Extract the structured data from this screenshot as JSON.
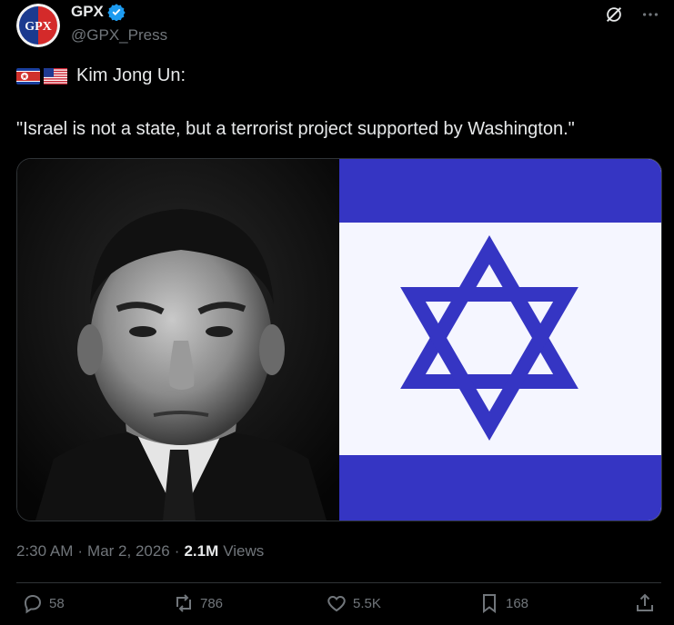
{
  "author": {
    "avatar_text": "GPX",
    "display_name": "GPX",
    "handle": "@GPX_Press",
    "verified_badge_icon": "verified-badge-icon"
  },
  "top_actions": {
    "grok_icon": "grok-icon",
    "more_icon": "more-icon"
  },
  "post": {
    "flags": [
      "north-korea-flag",
      "usa-flag"
    ],
    "speaker": "Kim Jong Un:",
    "quote": "\"Israel is not a state, but a terrorist project supported by Washington.\""
  },
  "media": {
    "left_image": "portrait-photo",
    "right_image": "israel-flag",
    "flag_colors": {
      "blue": "#3535c3",
      "white": "#f5f6ff"
    }
  },
  "meta": {
    "time": "2:30 AM",
    "separator": "·",
    "date": "Mar 2, 2026",
    "views_count": "2.1M",
    "views_label": "Views"
  },
  "actions": {
    "replies": "58",
    "reposts": "786",
    "likes": "5.5K",
    "bookmarks": "168"
  },
  "colors": {
    "background": "#000000",
    "text": "#e7e9ea",
    "muted": "#71767b",
    "verified": "#1d9bf0"
  }
}
